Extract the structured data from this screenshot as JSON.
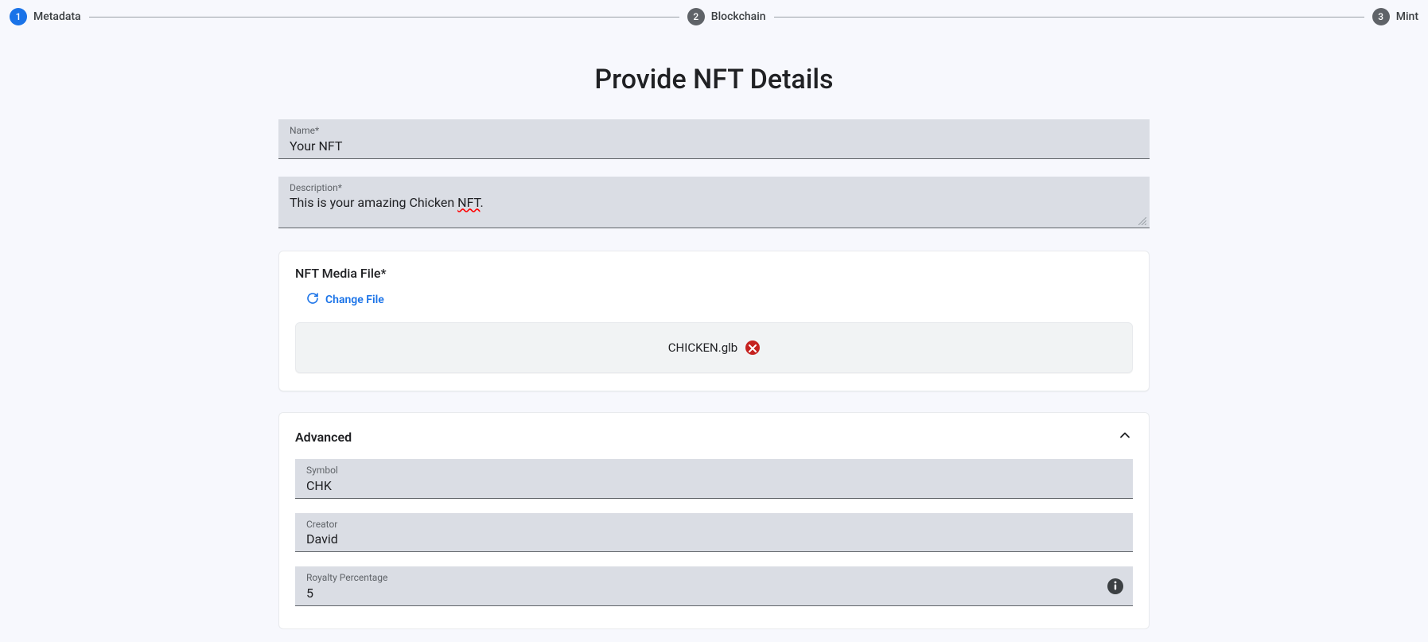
{
  "stepper": {
    "steps": [
      {
        "num": "1",
        "label": "Metadata",
        "active": true
      },
      {
        "num": "2",
        "label": "Blockchain",
        "active": false
      },
      {
        "num": "3",
        "label": "Mint",
        "active": false
      }
    ]
  },
  "page_title": "Provide NFT Details",
  "fields": {
    "name": {
      "label": "Name*",
      "value": "Your NFT"
    },
    "description": {
      "label": "Description*",
      "value_prefix": "This is your amazing Chicken ",
      "value_spellcheck": "NFT",
      "value_suffix": "."
    }
  },
  "media": {
    "section_label": "NFT Media File*",
    "change_label": "Change File",
    "file_name": "CHICKEN.glb"
  },
  "advanced": {
    "title": "Advanced",
    "symbol": {
      "label": "Symbol",
      "value": "CHK"
    },
    "creator": {
      "label": "Creator",
      "value": "David"
    },
    "royalty": {
      "label": "Royalty Percentage",
      "value": "5"
    }
  }
}
